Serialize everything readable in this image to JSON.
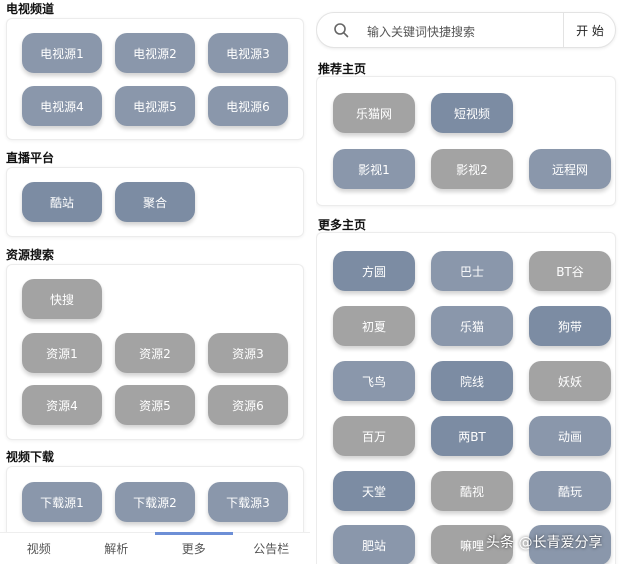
{
  "left": {
    "sections": [
      {
        "title": "电视频道",
        "buttons": [
          "电视源1",
          "电视源2",
          "电视源3",
          "电视源4",
          "电视源5",
          "电视源6"
        ]
      },
      {
        "title": "直播平台",
        "buttons": [
          "酷站",
          "聚合"
        ]
      },
      {
        "title": "资源搜索",
        "buttons": [
          "快搜",
          "资源1",
          "资源2",
          "资源3",
          "资源4",
          "资源5",
          "资源6"
        ]
      },
      {
        "title": "视频下载",
        "buttons": [
          "下载源1",
          "下载源2",
          "下载源3"
        ]
      }
    ],
    "nav": [
      "视频",
      "解析",
      "更多",
      "公告栏"
    ]
  },
  "right": {
    "search": {
      "placeholder": "输入关键词快捷搜索",
      "button": "开 始"
    },
    "recommend": {
      "title": "推荐主页",
      "buttons": [
        "乐猫网",
        "短视频",
        "影视1",
        "影视2",
        "远程网"
      ]
    },
    "more": {
      "title": "更多主页",
      "buttons": [
        "方圆",
        "巴士",
        "BT谷",
        "初夏",
        "乐猫",
        "狗带",
        "飞鸟",
        "院线",
        "妖妖",
        "百万",
        "两BT",
        "动画",
        "天堂",
        "酷视",
        "酷玩",
        "肥站",
        "嘛哩",
        ""
      ]
    }
  },
  "watermark": "头条 @长青爱分享"
}
